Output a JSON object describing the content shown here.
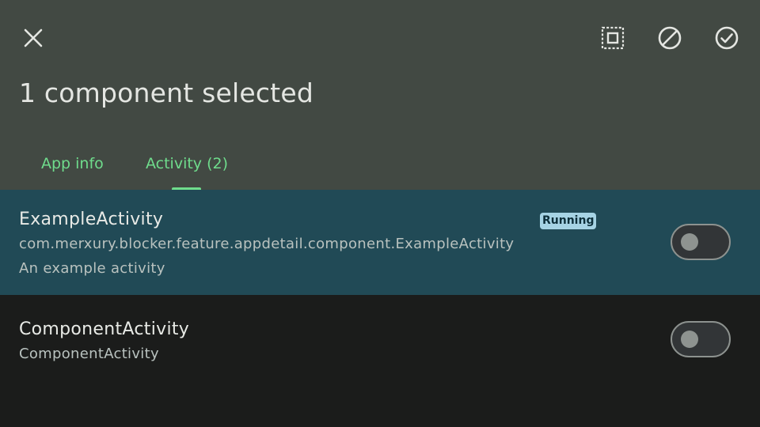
{
  "header": {
    "title": "1 component selected",
    "close_icon": "close-icon",
    "actions": [
      "select-all-icon",
      "block-icon",
      "check-circle-icon"
    ]
  },
  "tabs": [
    {
      "label": "App info",
      "selected": false
    },
    {
      "label": "Activity (2)",
      "selected": true
    }
  ],
  "components": [
    {
      "name": "ExampleActivity",
      "package": "com.merxury.blocker.feature.appdetail.component.ExampleActivity",
      "description": "An example activity",
      "badge": "Running",
      "enabled": false,
      "selected": true
    },
    {
      "name": "ComponentActivity",
      "package": "ComponentActivity",
      "enabled": false,
      "selected": false
    }
  ],
  "colors": {
    "header_bg": "#424943",
    "accent": "#6fdc8c",
    "selected_row_bg": "#214a56",
    "page_bg": "#1b1c1b",
    "badge_bg": "#a6d3e4"
  }
}
